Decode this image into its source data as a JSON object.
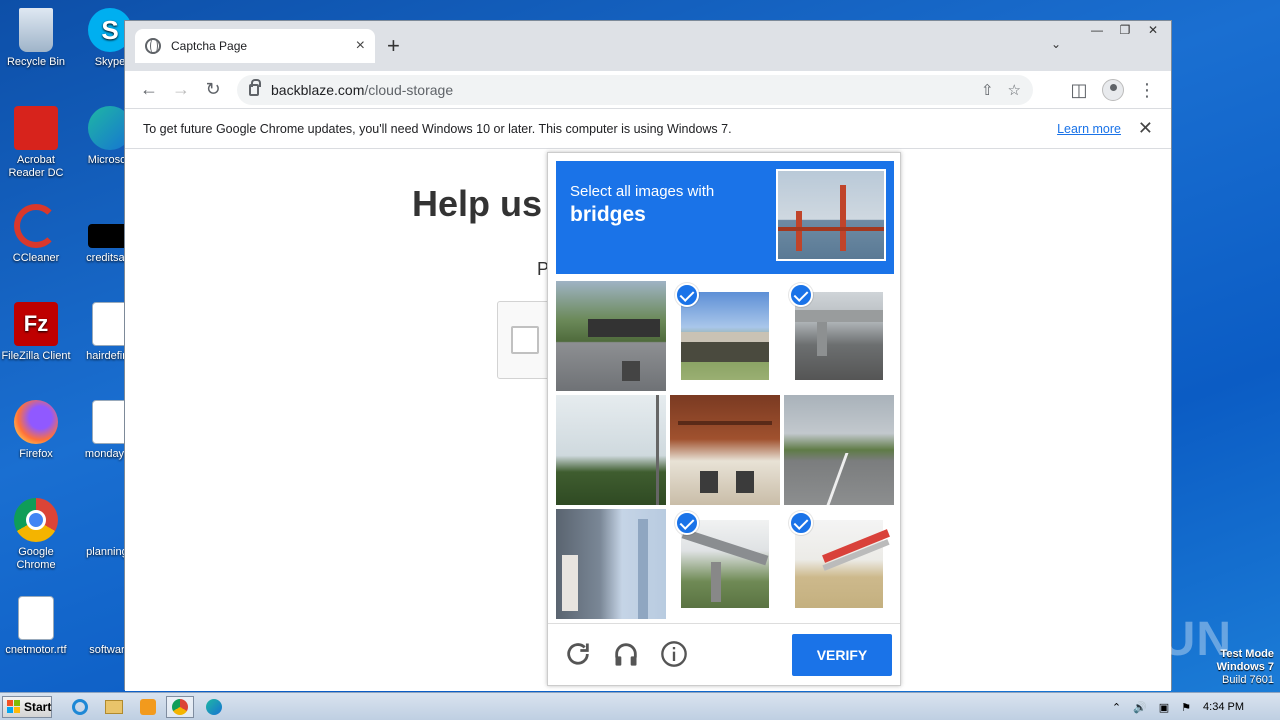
{
  "desktop": {
    "icons": [
      {
        "label": "Recycle Bin"
      },
      {
        "label": "Skype"
      },
      {
        "label": "Acrobat Reader DC"
      },
      {
        "label": "Microsoft"
      },
      {
        "label": "CCleaner"
      },
      {
        "label": "creditsam"
      },
      {
        "label": "FileZilla Client"
      },
      {
        "label": "hairdefinit"
      },
      {
        "label": "Firefox"
      },
      {
        "label": "mondaysc"
      },
      {
        "label": "Google Chrome"
      },
      {
        "label": "planningn"
      },
      {
        "label": "cnetmotor.rtf"
      },
      {
        "label": "software"
      }
    ]
  },
  "browser": {
    "tab": {
      "title": "Captcha Page",
      "close": "×"
    },
    "new_tab": "+",
    "url": {
      "host": "backblaze.com",
      "path": "/cloud-storage"
    },
    "infobar": {
      "message": "To get future Google Chrome updates, you'll need Windows 10 or later. This computer is using Windows 7.",
      "link": "Learn more",
      "close": "✕"
    }
  },
  "page": {
    "heading": "Help us",
    "sub": "P"
  },
  "captcha": {
    "instruction": "Select all images with",
    "target": "bridges",
    "cells": [
      {
        "index": 0,
        "selected": false
      },
      {
        "index": 1,
        "selected": true
      },
      {
        "index": 2,
        "selected": true
      },
      {
        "index": 3,
        "selected": false
      },
      {
        "index": 4,
        "selected": false
      },
      {
        "index": 5,
        "selected": false
      },
      {
        "index": 6,
        "selected": false
      },
      {
        "index": 7,
        "selected": true
      },
      {
        "index": 8,
        "selected": true
      }
    ],
    "verify_label": "VERIFY"
  },
  "taskbar": {
    "start_label": "Start",
    "clock": "4:34 PM"
  },
  "overlay": {
    "watermark": "ANY RUN",
    "testmode_line1": "Test Mode",
    "testmode_line2": "Windows 7",
    "testmode_line3": "Build 7601"
  }
}
